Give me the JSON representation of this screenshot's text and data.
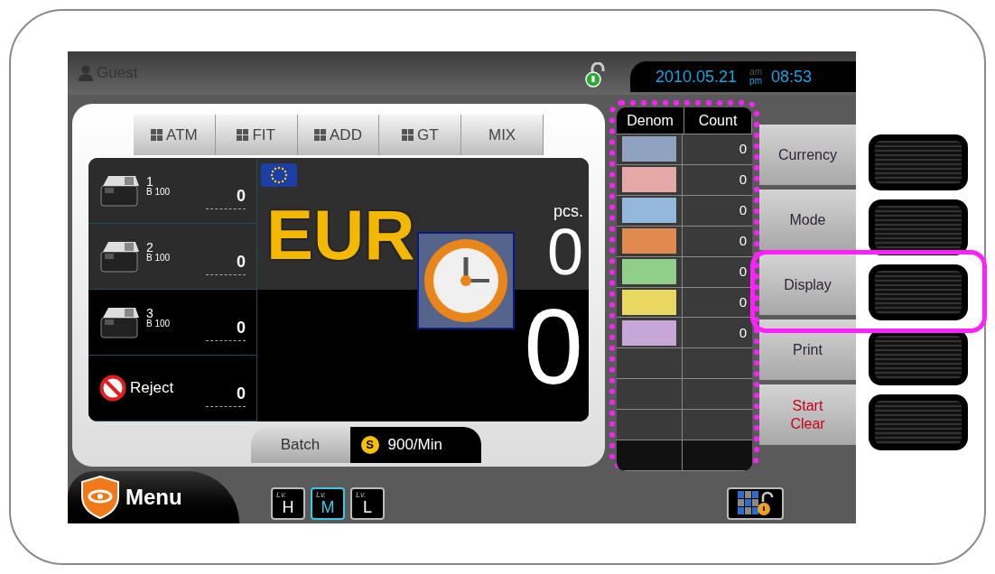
{
  "user": {
    "name": "Guest"
  },
  "datetime": {
    "date": "2010.05.21",
    "am": "am",
    "pm": "pm",
    "time": "08:53"
  },
  "mode_tabs": [
    {
      "label": "ATM",
      "kind": "grid"
    },
    {
      "label": "FIT",
      "kind": "grid"
    },
    {
      "label": "ADD",
      "kind": "grid"
    },
    {
      "label": "GT",
      "kind": "grid"
    },
    {
      "label": "MIX",
      "kind": "plain"
    }
  ],
  "pockets": [
    {
      "kind": "machine",
      "number": "1",
      "sub": "B 100",
      "count": "0"
    },
    {
      "kind": "machine",
      "number": "2",
      "sub": "B 100",
      "count": "0"
    },
    {
      "kind": "machine",
      "number": "3",
      "sub": "B 100",
      "count": "0"
    },
    {
      "kind": "reject",
      "label": "Reject",
      "count": "0"
    }
  ],
  "currency": {
    "code": "EUR"
  },
  "pcs": {
    "label": "pcs.",
    "value": "0"
  },
  "total": "0",
  "status": {
    "mode": "Batch",
    "speed_icon": "S",
    "speed": "900/Min"
  },
  "table": {
    "highlighted": true,
    "columns": [
      "Denom",
      "Count"
    ],
    "rows": [
      {
        "color": "#8fa3c0",
        "count": "0"
      },
      {
        "color": "#e6a7a7",
        "count": "0"
      },
      {
        "color": "#93b8dc",
        "count": "0"
      },
      {
        "color": "#e08a50",
        "count": "0"
      },
      {
        "color": "#8fcf8a",
        "count": "0"
      },
      {
        "color": "#e8d860",
        "count": "0"
      },
      {
        "color": "#c7a6d8",
        "count": "0"
      }
    ]
  },
  "side_buttons": [
    {
      "lines": [
        "Currency"
      ],
      "kind": "normal"
    },
    {
      "lines": [
        "Mode"
      ],
      "kind": "normal"
    },
    {
      "lines": [
        "Display"
      ],
      "kind": "normal"
    },
    {
      "lines": [
        "Print"
      ],
      "kind": "normal"
    },
    {
      "lines": [
        "Start",
        "Clear"
      ],
      "kind": "alert"
    }
  ],
  "hardware_keys": [
    {
      "highlighted": false
    },
    {
      "highlighted": false
    },
    {
      "highlighted": true
    },
    {
      "highlighted": false
    },
    {
      "highlighted": false
    }
  ],
  "menu": {
    "label": "Menu"
  },
  "levels": [
    {
      "prefix": "Lv.",
      "label": "H",
      "selected": false
    },
    {
      "prefix": "Lv.",
      "label": "M",
      "selected": true
    },
    {
      "prefix": "Lv.",
      "label": "L",
      "selected": false
    }
  ]
}
